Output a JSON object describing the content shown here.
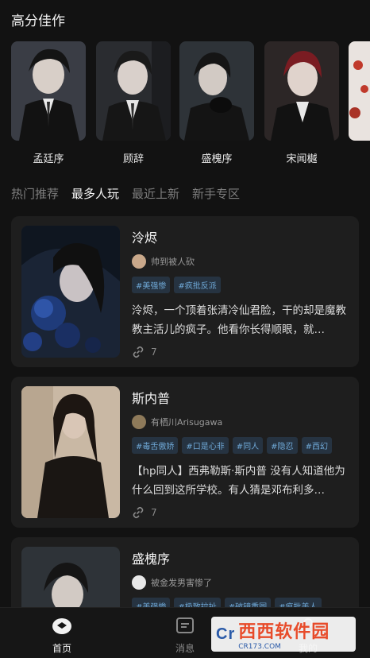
{
  "section_title": "高分佳作",
  "featured": [
    {
      "name": "孟廷序"
    },
    {
      "name": "顾辞"
    },
    {
      "name": "盛槐序"
    },
    {
      "name": "宋闻樾"
    }
  ],
  "tabs": [
    {
      "label": "热门推荐",
      "active": false
    },
    {
      "label": "最多人玩",
      "active": true
    },
    {
      "label": "最近上新",
      "active": false
    },
    {
      "label": "新手专区",
      "active": false
    }
  ],
  "cards": [
    {
      "title": "泠烬",
      "author": "帅到被人砍",
      "tags": [
        "#美强惨",
        "#疯批反派"
      ],
      "description": "泠烬，一个顶着张清冷仙君脸，干的却是魔教教主活儿的疯子。他看你长得顺眼，就…",
      "count": "7"
    },
    {
      "title": "斯内普",
      "author": "有栖川Arisugawa",
      "tags": [
        "#毒舌傲娇",
        "#口是心非",
        "#同人",
        "#隐忍",
        "#西幻"
      ],
      "description": "【hp同人】西弗勒斯·斯内普 没有人知道他为什么回到这所学校。有人猜是邓布利多…",
      "count": "7"
    },
    {
      "title": "盛槐序",
      "author": "被金发男害惨了",
      "tags": [
        "#美强惨",
        "#极致拉扯",
        "#破镜重圆",
        "#疯批美人"
      ],
      "description": "",
      "count": ""
    }
  ],
  "nav": [
    {
      "label": "首页",
      "active": true
    },
    {
      "label": "消息",
      "active": false
    },
    {
      "label": "我的",
      "active": false
    }
  ],
  "watermark": {
    "big": "西西软件园",
    "small": "CR173.COM",
    "mark": "Cr"
  }
}
